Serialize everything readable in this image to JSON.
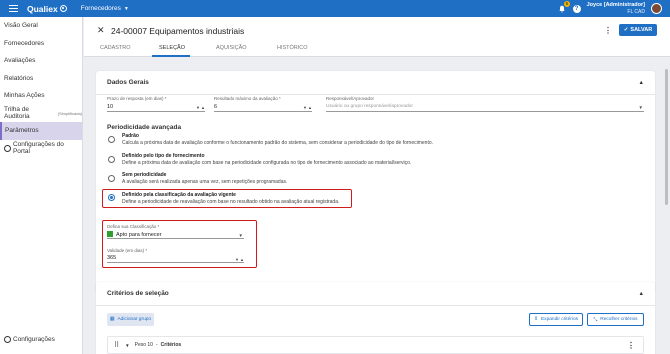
{
  "topbar": {
    "brand": "Qualiex",
    "module": "Fornecedores",
    "notification_count": "5",
    "help_symbol": "?",
    "user_name": "Joyce [Administrador]",
    "user_company": "FL CAD"
  },
  "sidebar": {
    "items": [
      {
        "label": "Visão Geral"
      },
      {
        "label": "Fornecedores"
      },
      {
        "label": "Avaliações"
      },
      {
        "label": "Relatórios"
      },
      {
        "label": "Minhas Ações"
      },
      {
        "label": "Trilha de Auditoria",
        "tag": "(Simplificada)"
      },
      {
        "label": "Parâmetros"
      },
      {
        "label": "Configurações do Portal"
      }
    ],
    "bottom_label": "Configurações"
  },
  "header": {
    "title": "24-00007 Equipamentos industriais",
    "save_label": "SALVAR",
    "tabs": [
      "CADASTRO",
      "SELEÇÃO",
      "AQUISIÇÃO",
      "HISTÓRICO"
    ],
    "active_tab": "SELEÇÃO"
  },
  "dados_gerais": {
    "title": "Dados Gerais",
    "prazo_label": "Prazo de resposta (em dias) *",
    "prazo_value": "10",
    "resultado_label": "Resultado máximo da avaliação *",
    "resultado_value": "6",
    "responsavel_label": "Responsável/Aprovador",
    "responsavel_placeholder": "Usuário ou grupo responsável/aprovador"
  },
  "periodicidade": {
    "title": "Periodicidade avançada",
    "options": [
      {
        "title": "Padrão",
        "desc": "Calcula a próxima data de avaliação conforme o funcionamento padrão do sistema, sem considerar a periodicidade do tipo de fornecimento.",
        "checked": false
      },
      {
        "title": "Definido pelo tipo de fornecimento",
        "desc": "Define a próxima data de avaliação com base na periodicidade configurada no tipo de fornecimento associado ao material/serviço.",
        "checked": false
      },
      {
        "title": "Sem periodicidade",
        "desc": "A avaliação será realizada apenas uma vez, sem repetições programadas.",
        "checked": false
      },
      {
        "title": "Definido pela classificação da avaliação vigente",
        "desc": "Define a periodicidade de reavaliação com base no resultado obtido na avaliação atual registrada.",
        "checked": true
      }
    ],
    "classificacao_label": "Defina sua Classificação *",
    "classificacao_value": "Apto para fornecer",
    "classificacao_color": "#2e9e2e",
    "validade_label": "Validade (em dias) *",
    "validade_value": "365"
  },
  "criterios": {
    "title": "Critérios de seleção",
    "add_group_label": "Adicionar grupo",
    "expand_label": "Expandir critérios",
    "collapse_label": "Recolher critérios",
    "row_weight": "Peso 10",
    "row_label": "Critérios"
  },
  "colors": {
    "primary": "#1f6fc5",
    "highlight": "#d11b1b",
    "active_nav": "#d8d4ec"
  }
}
